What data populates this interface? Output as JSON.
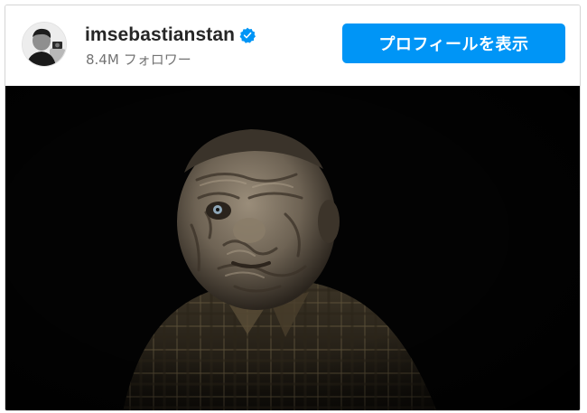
{
  "post_header": {
    "username": "imsebastianstan",
    "followers_count": "8.4M",
    "followers_label": "フォロワー",
    "view_profile_label": "プロフィールを表示"
  },
  "icons": {
    "verified": "verified-badge-icon",
    "avatar": "profile-avatar"
  },
  "colors": {
    "button": "#0095f6",
    "verified": "#0095f6",
    "username": "#262626",
    "secondary_text": "#737373",
    "media_background": "#030303"
  }
}
